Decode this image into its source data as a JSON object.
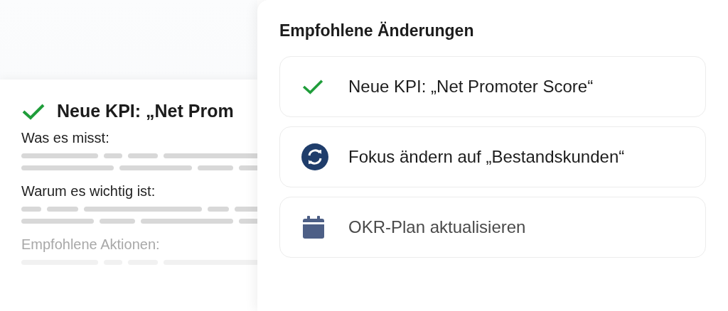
{
  "detail_card": {
    "title": "Neue KPI: „Net Prom",
    "sections": [
      {
        "label": "Was es misst:",
        "muted": false
      },
      {
        "label": "Warum es wichtig ist:",
        "muted": false
      },
      {
        "label": "Empfohlene Aktionen:",
        "muted": true
      }
    ]
  },
  "changes_panel": {
    "title": "Empfohlene Änderungen",
    "items": [
      {
        "kind": "check",
        "label": "Neue KPI: „Net Promoter Score“",
        "muted": false
      },
      {
        "kind": "refresh",
        "label": "Fokus ändern auf „Bestandskunden“",
        "muted": false
      },
      {
        "kind": "calendar",
        "label": "OKR-Plan aktualisieren",
        "muted": true
      }
    ]
  }
}
